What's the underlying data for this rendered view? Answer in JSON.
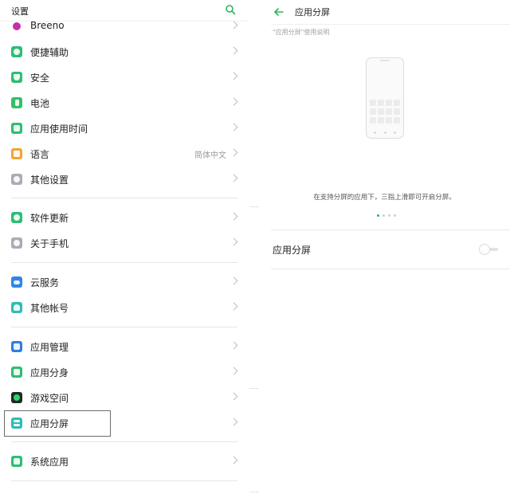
{
  "left": {
    "header": {
      "title": "设置",
      "search_icon": "search-icon"
    },
    "groups": [
      [
        {
          "label": "Breeno",
          "icon": "breeno-icon",
          "color": "#c72fa8"
        },
        {
          "label": "便捷辅助",
          "icon": "accessibility-icon",
          "color": "#2ebd76"
        },
        {
          "label": "安全",
          "icon": "shield-icon",
          "color": "#2ebd76"
        },
        {
          "label": "电池",
          "icon": "battery-icon",
          "color": "#34c06a"
        },
        {
          "label": "应用使用时间",
          "icon": "app-usage-icon",
          "color": "#2ebd76"
        },
        {
          "label": "语言",
          "icon": "language-icon",
          "color": "#f2a33a",
          "value": "简体中文"
        },
        {
          "label": "其他设置",
          "icon": "other-settings-icon",
          "color": "#a8adb5"
        }
      ],
      [
        {
          "label": "软件更新",
          "icon": "software-update-icon",
          "color": "#2ebd76"
        },
        {
          "label": "关于手机",
          "icon": "about-phone-icon",
          "color": "#a8adb5"
        }
      ],
      [
        {
          "label": "云服务",
          "icon": "cloud-icon",
          "color": "#2f86e8"
        },
        {
          "label": "其他帐号",
          "icon": "account-icon",
          "color": "#2fbdb3"
        }
      ],
      [
        {
          "label": "应用管理",
          "icon": "app-management-icon",
          "color": "#2f7de0"
        },
        {
          "label": "应用分身",
          "icon": "app-clone-icon",
          "color": "#2ebd76"
        },
        {
          "label": "游戏空间",
          "icon": "game-space-icon",
          "color": "#1f2b26"
        },
        {
          "label": "应用分屏",
          "icon": "split-screen-icon",
          "color": "#2fbdb3"
        }
      ],
      [
        {
          "label": "系统应用",
          "icon": "system-apps-icon",
          "color": "#2ebd76"
        }
      ]
    ]
  },
  "right": {
    "header": {
      "title": "应用分屏",
      "back_icon": "back-arrow-icon"
    },
    "usage_label": "\"应用分屏\"使用说明",
    "description": "在支持分屏的应用下，三指上滑即可开启分屏。",
    "page_indicator": {
      "total": 4,
      "active": 0
    },
    "toggle_row": {
      "label": "应用分屏",
      "enabled": false
    },
    "accent_color": "#2fb35d"
  }
}
